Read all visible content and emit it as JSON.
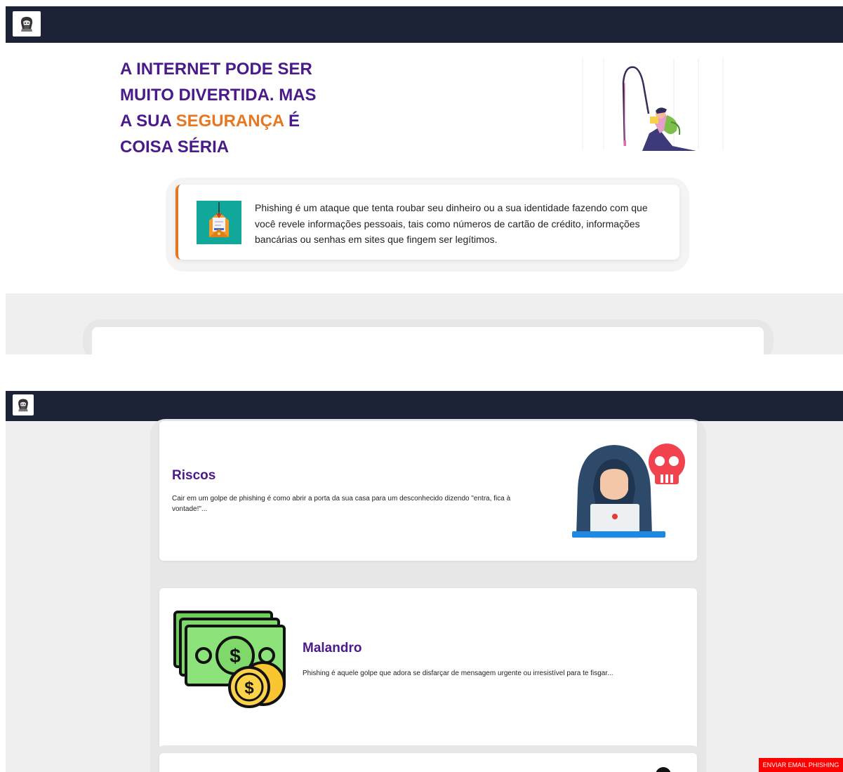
{
  "hero": {
    "title_line1": "A INTERNET PODE SER",
    "title_line2": "MUITO DIVERTIDA. MAS",
    "title_line3_pre": "A SUA ",
    "title_highlight": "SEGURANÇA",
    "title_line3_post": " É",
    "title_line4": "COISA SÉRIA"
  },
  "intro": {
    "text": "Phishing é um ataque que tenta roubar seu dinheiro ou a sua identidade fazendo com que você revele informações pessoais, tais como números de cartão de crédito, informações bancárias ou senhas em sites que fingem ser legítimos."
  },
  "cards": [
    {
      "title": "Riscos",
      "text": "Cair em um golpe de phishing é como abrir a porta da sua casa para um desconhecido dizendo \"entra, fica à vontade!\"...",
      "icon": "hacker-icon"
    },
    {
      "title": "Malandro",
      "text": "Phishing é aquele golpe que adora se disfarçar de mensagem urgente ou irresistível para te fisgar...",
      "icon": "money-icon"
    }
  ],
  "send_button": "ENVIAR EMAIL PHISHING",
  "colors": {
    "navbar": "#1c2337",
    "title_purple": "#4a1a8a",
    "accent_orange": "#e87722",
    "button_red": "#ff0000"
  }
}
